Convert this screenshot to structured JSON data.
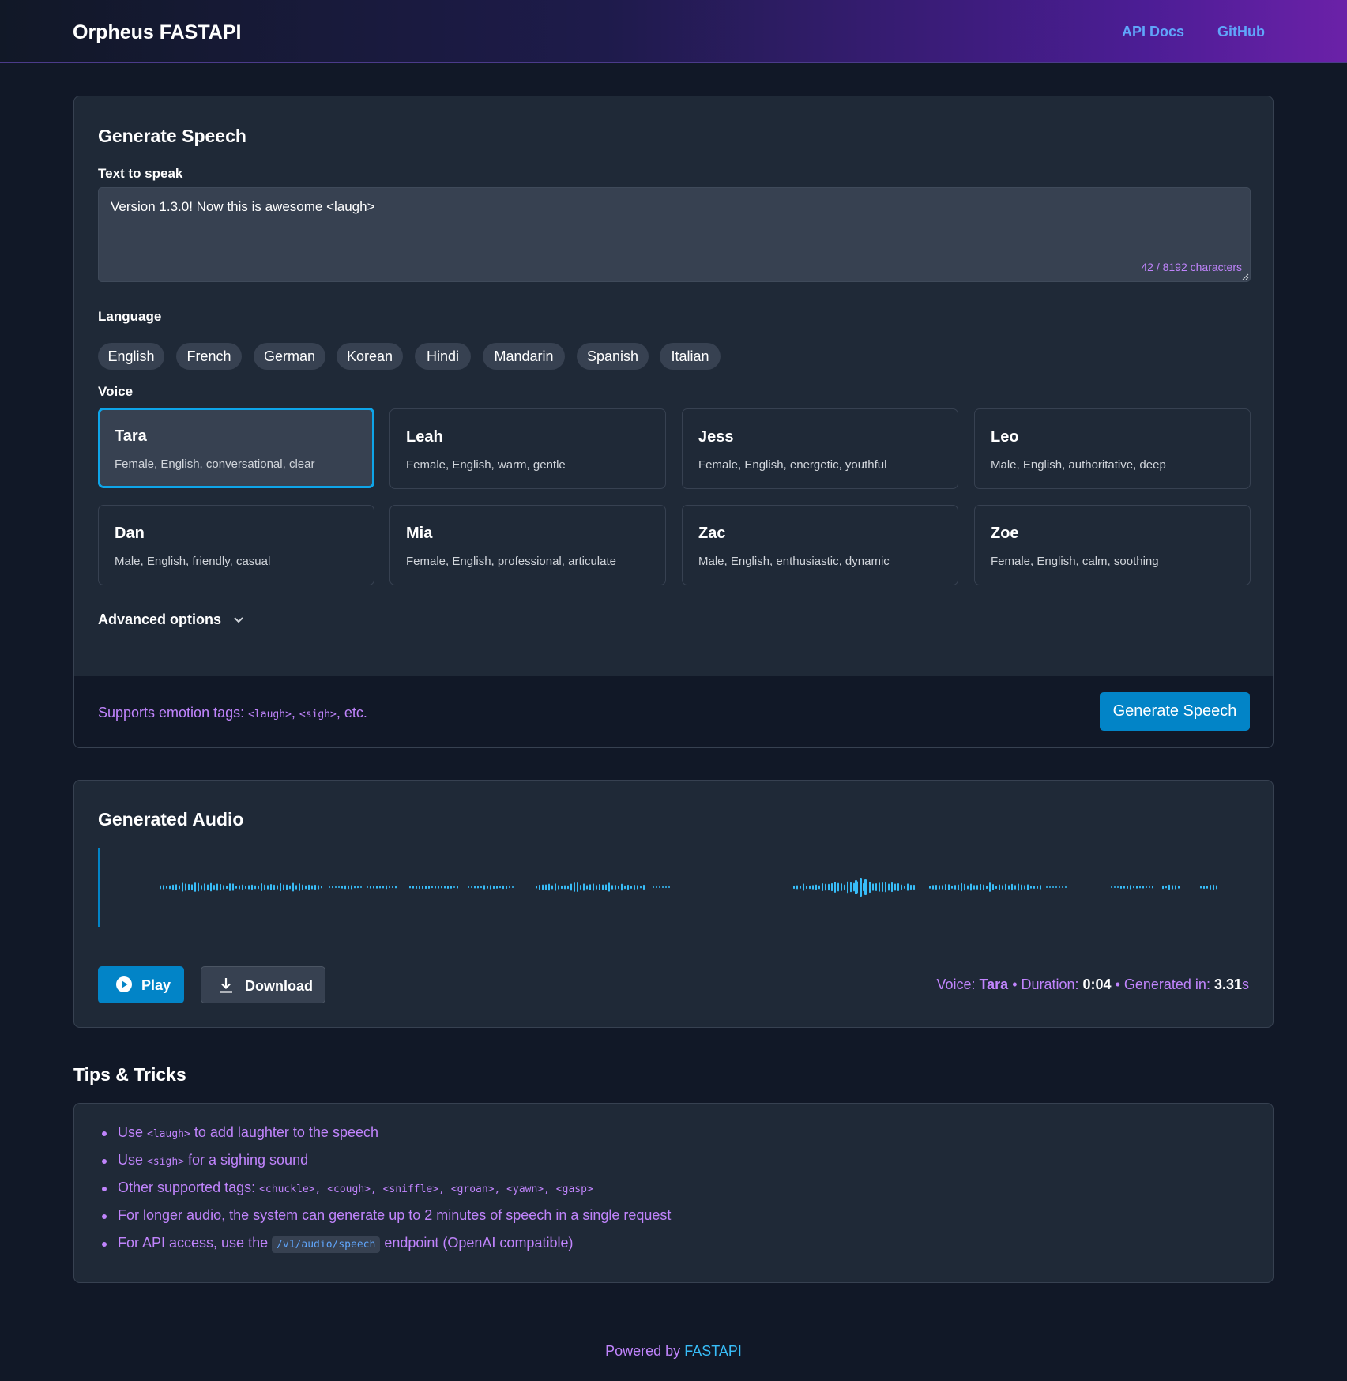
{
  "header": {
    "brand": "Orpheus FASTAPI",
    "nav": [
      {
        "label": "API Docs"
      },
      {
        "label": "GitHub"
      }
    ]
  },
  "generate": {
    "title": "Generate Speech",
    "text_label": "Text to speak",
    "text_value": "Version 1.3.0! Now this is awesome <laugh>",
    "char_count": "42 / 8192 characters",
    "language_label": "Language",
    "languages": [
      "English",
      "French",
      "German",
      "Korean",
      "Hindi",
      "Mandarin",
      "Spanish",
      "Italian"
    ],
    "voice_label": "Voice",
    "selected_voice": "Tara",
    "voices": [
      {
        "name": "Tara",
        "desc": "Female, English, conversational, clear"
      },
      {
        "name": "Leah",
        "desc": "Female, English, warm, gentle"
      },
      {
        "name": "Jess",
        "desc": "Female, English, energetic, youthful"
      },
      {
        "name": "Leo",
        "desc": "Male, English, authoritative, deep"
      },
      {
        "name": "Dan",
        "desc": "Male, English, friendly, casual"
      },
      {
        "name": "Mia",
        "desc": "Female, English, professional, articulate"
      },
      {
        "name": "Zac",
        "desc": "Male, English, enthusiastic, dynamic"
      },
      {
        "name": "Zoe",
        "desc": "Female, English, calm, soothing"
      }
    ],
    "advanced_label": "Advanced options",
    "hint_prefix": "Supports emotion tags: ",
    "hint_tag1": "<laugh>",
    "hint_sep": ", ",
    "hint_tag2": "<sigh>",
    "hint_suffix": ", etc.",
    "submit_label": "Generate Speech"
  },
  "audio": {
    "title": "Generated Audio",
    "play_label": "Play",
    "download_label": "Download",
    "voice_label": "Voice: ",
    "voice_value": "Tara",
    "duration_label": " • Duration: ",
    "duration_value": "0:04",
    "generated_label": " • Generated in: ",
    "generated_value": "3.31",
    "generated_unit": "s",
    "wave_color": "#38bdf8"
  },
  "tips": {
    "title": "Tips & Tricks",
    "t1_a": "Use ",
    "t1_code": "<laugh>",
    "t1_b": " to add laughter to the speech",
    "t2_a": "Use ",
    "t2_code": "<sigh>",
    "t2_b": " for a sighing sound",
    "t3_a": "Other supported tags: ",
    "t3_code": "<chuckle>, <cough>, <sniffle>, <groan>, <yawn>, <gasp>",
    "t4": "For longer audio, the system can generate up to 2 minutes of speech in a single request",
    "t5_a": "For API access, use the ",
    "t5_code": "/v1/audio/speech",
    "t5_b": " endpoint (OpenAI compatible)"
  },
  "footer": {
    "prefix": "Powered by ",
    "link": "FASTAPI"
  },
  "colors": {
    "accent": "#0284c7",
    "selected_border": "#0ea5e9",
    "purple_text": "#c084fc",
    "link": "#60a5fa"
  }
}
